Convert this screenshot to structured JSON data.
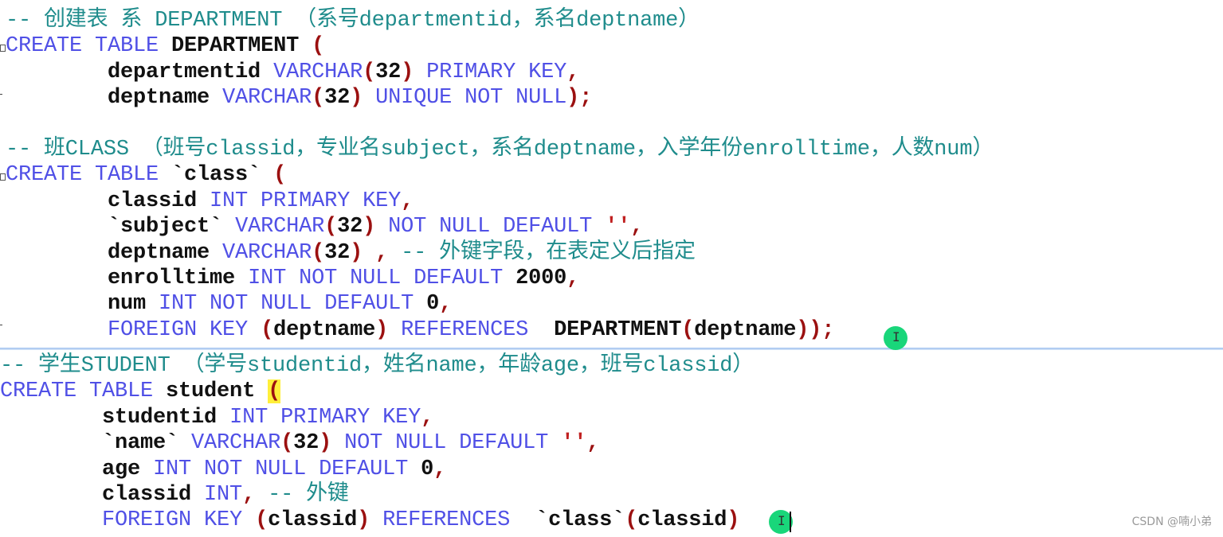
{
  "editor": {
    "top_section": [
      [
        [
          "-- 创建表 系 DEPARTMENT （系号departmentid，系名deptname）",
          "c"
        ]
      ],
      [
        [
          "CREATE TABLE ",
          "k"
        ],
        [
          "DEPARTMENT ",
          "i"
        ],
        [
          "(",
          "p"
        ]
      ],
      [
        [
          "        departmentid ",
          "i"
        ],
        [
          "VARCHAR",
          "k"
        ],
        [
          "(",
          "p"
        ],
        [
          "32",
          "n"
        ],
        [
          ")",
          "p"
        ],
        [
          " PRIMARY KEY",
          "k"
        ],
        [
          ",",
          "p"
        ]
      ],
      [
        [
          "        deptname ",
          "i"
        ],
        [
          "VARCHAR",
          "k"
        ],
        [
          "(",
          "p"
        ],
        [
          "32",
          "n"
        ],
        [
          ")",
          "p"
        ],
        [
          " UNIQUE NOT NULL",
          "k"
        ],
        [
          ");",
          "p"
        ]
      ],
      [],
      [
        [
          "-- 班CLASS （班号classid，专业名subject，系名deptname，入学年份enrolltime，人数num）",
          "c"
        ]
      ],
      [
        [
          "CREATE TABLE ",
          "k"
        ],
        [
          "`class` ",
          "i"
        ],
        [
          "(",
          "p"
        ]
      ],
      [
        [
          "        classid ",
          "i"
        ],
        [
          "INT PRIMARY KEY",
          "k"
        ],
        [
          ",",
          "p"
        ]
      ],
      [
        [
          "        `subject` ",
          "i"
        ],
        [
          "VARCHAR",
          "k"
        ],
        [
          "(",
          "p"
        ],
        [
          "32",
          "n"
        ],
        [
          ")",
          "p"
        ],
        [
          " NOT NULL DEFAULT ",
          "k"
        ],
        [
          "''",
          "s"
        ],
        [
          ",",
          "p"
        ]
      ],
      [
        [
          "        deptname ",
          "i"
        ],
        [
          "VARCHAR",
          "k"
        ],
        [
          "(",
          "p"
        ],
        [
          "32",
          "n"
        ],
        [
          ")",
          "p"
        ],
        [
          " , ",
          "p"
        ],
        [
          "-- 外键字段，在表定义后指定",
          "c"
        ]
      ],
      [
        [
          "        enrolltime ",
          "i"
        ],
        [
          "INT NOT NULL DEFAULT ",
          "k"
        ],
        [
          "2000",
          "n"
        ],
        [
          ",",
          "p"
        ]
      ],
      [
        [
          "        num ",
          "i"
        ],
        [
          "INT NOT NULL DEFAULT ",
          "k"
        ],
        [
          "0",
          "n"
        ],
        [
          ",",
          "p"
        ]
      ],
      [
        [
          "        FOREIGN KEY ",
          "k"
        ],
        [
          "(",
          "p"
        ],
        [
          "deptname",
          "i"
        ],
        [
          ")",
          "p"
        ],
        [
          " REFERENCES  ",
          "k"
        ],
        [
          "DEPARTMENT",
          "i"
        ],
        [
          "(",
          "p"
        ],
        [
          "deptname",
          "i"
        ],
        [
          "));",
          "p"
        ]
      ]
    ],
    "bottom_section": [
      [
        [
          "-- 学生STUDENT （学号studentid，姓名name，年龄age，班号classid）",
          "c"
        ]
      ],
      [
        [
          "CREATE TABLE ",
          "k"
        ],
        [
          "student ",
          "i"
        ],
        [
          "(",
          "p",
          "hl"
        ]
      ],
      [
        [
          "        studentid ",
          "i"
        ],
        [
          "INT PRIMARY KEY",
          "k"
        ],
        [
          ",",
          "p"
        ]
      ],
      [
        [
          "        `name` ",
          "i"
        ],
        [
          "VARCHAR",
          "k"
        ],
        [
          "(",
          "p"
        ],
        [
          "32",
          "n"
        ],
        [
          ")",
          "p"
        ],
        [
          " NOT NULL DEFAULT ",
          "k"
        ],
        [
          "''",
          "s"
        ],
        [
          ",",
          "p"
        ]
      ],
      [
        [
          "        age ",
          "i"
        ],
        [
          "INT NOT NULL DEFAULT ",
          "k"
        ],
        [
          "0",
          "n"
        ],
        [
          ",",
          "p"
        ]
      ],
      [
        [
          "        classid ",
          "i"
        ],
        [
          "INT",
          "k"
        ],
        [
          ", ",
          "p"
        ],
        [
          "-- 外键",
          "c"
        ]
      ],
      [
        [
          "        FOREIGN KEY ",
          "k"
        ],
        [
          "(",
          "p"
        ],
        [
          "classid",
          "i"
        ],
        [
          ")",
          "p"
        ],
        [
          " REFERENCES  ",
          "k"
        ],
        [
          "`class`",
          "i"
        ],
        [
          "(",
          "p"
        ],
        [
          "classid",
          "i"
        ],
        [
          ")",
          "p"
        ]
      ]
    ]
  },
  "colors": {
    "comment": "#1f8c8c",
    "keyword": "#5050e6",
    "punctuation": "#9b1010",
    "identifier": "#111111",
    "string": "#c02020",
    "bracket_highlight": "#ffef3a",
    "cursor_marker": "#19d67a"
  },
  "watermark": "CSDN @喃小弟"
}
